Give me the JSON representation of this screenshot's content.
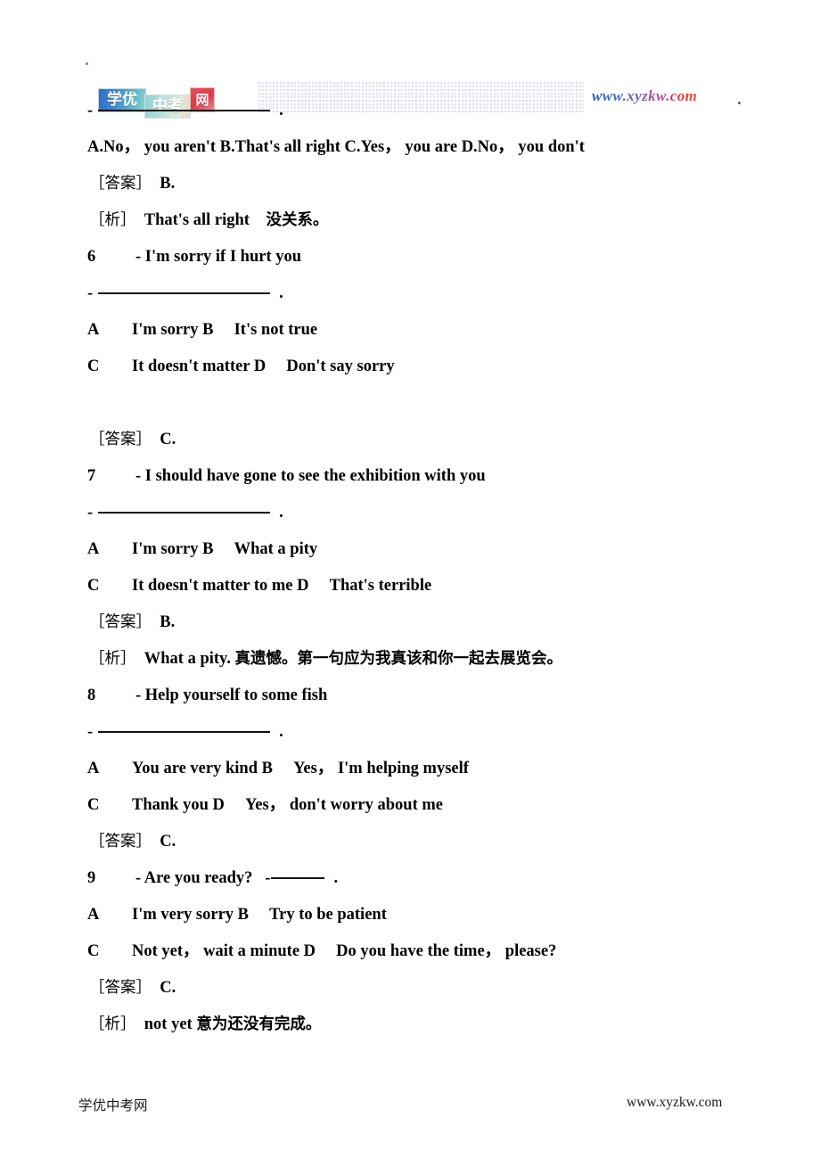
{
  "header": {
    "logo": {
      "seg1": "学优",
      "seg2": "中考",
      "seg3": "网",
      "alt": "学优中考网"
    },
    "url": "www.xyzkw.com"
  },
  "footer": {
    "site_name": "学优中考网",
    "url": "www.xyzkw.com"
  },
  "labels": {
    "answer": "［答案］",
    "analysis": "［析］",
    "dash": "-",
    "period": "."
  },
  "lines": {
    "q5_blank_dash": "-",
    "q5_options": "A.No，  you aren't B.That's all right   C.Yes，  you are D.No，  you don't",
    "q5_answer": "B.",
    "q5_analysis_en": "That's all right",
    "q5_analysis_cn": "没关系。",
    "q6_num": "6",
    "q6_stem": "- I'm sorry if I hurt you",
    "q6_optA_label": "A",
    "q6_optA_text": "I'm sorry B",
    "q6_optB_text": "It's not true",
    "q6_optC_label": "C",
    "q6_optC_text": "It doesn't matter D",
    "q6_optD_text": "Don't say sorry",
    "q6_answer": "C.",
    "q7_num": "7",
    "q7_stem": "- I should have gone to see the exhibition with you",
    "q7_optA_label": "A",
    "q7_optA_text": "I'm sorry B",
    "q7_optB_text": "What a pity",
    "q7_optC_label": "C",
    "q7_optC_text": "It doesn't matter to me D",
    "q7_optD_text": "That's terrible",
    "q7_answer": "B.",
    "q7_analysis_en": "What a pity.",
    "q7_analysis_cn": "真遗憾。第一句应为我真该和你一起去展览会。",
    "q8_num": "8",
    "q8_stem": "- Help yourself to some fish",
    "q8_optA_label": "A",
    "q8_optA_text": "You are very kind B",
    "q8_optB_text": "Yes，  I'm helping myself",
    "q8_optC_label": "C",
    "q8_optC_text": "Thank you D",
    "q8_optD_text": "Yes，  don't worry about me",
    "q8_answer": "C.",
    "q9_num": "9",
    "q9_stem": "- Are you ready?",
    "q9_optA_label": "A",
    "q9_optA_text": "I'm very sorry B",
    "q9_optB_text": "Try to be patient",
    "q9_optC_label": "C",
    "q9_optC_text": "Not yet，  wait a minute D",
    "q9_optD_text": "Do you have the time，  please?",
    "q9_answer": "C.",
    "q9_analysis_en": "not yet",
    "q9_analysis_cn": "意为还没有完成。"
  }
}
